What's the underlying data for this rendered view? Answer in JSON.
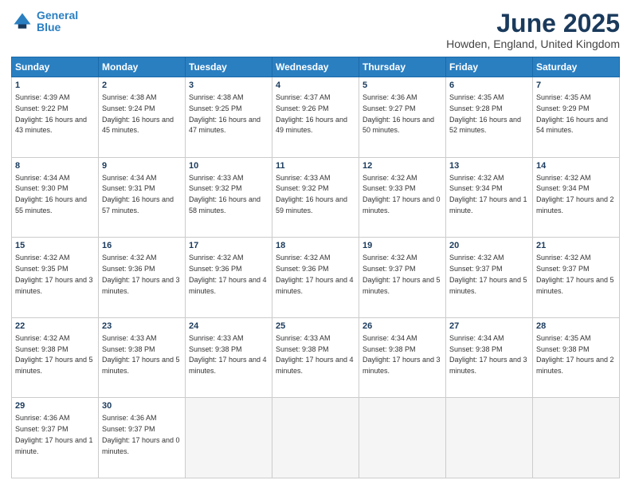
{
  "header": {
    "logo_line1": "General",
    "logo_line2": "Blue",
    "month": "June 2025",
    "location": "Howden, England, United Kingdom"
  },
  "weekdays": [
    "Sunday",
    "Monday",
    "Tuesday",
    "Wednesday",
    "Thursday",
    "Friday",
    "Saturday"
  ],
  "weeks": [
    [
      {
        "day": "1",
        "sunrise": "Sunrise: 4:39 AM",
        "sunset": "Sunset: 9:22 PM",
        "daylight": "Daylight: 16 hours and 43 minutes."
      },
      {
        "day": "2",
        "sunrise": "Sunrise: 4:38 AM",
        "sunset": "Sunset: 9:24 PM",
        "daylight": "Daylight: 16 hours and 45 minutes."
      },
      {
        "day": "3",
        "sunrise": "Sunrise: 4:38 AM",
        "sunset": "Sunset: 9:25 PM",
        "daylight": "Daylight: 16 hours and 47 minutes."
      },
      {
        "day": "4",
        "sunrise": "Sunrise: 4:37 AM",
        "sunset": "Sunset: 9:26 PM",
        "daylight": "Daylight: 16 hours and 49 minutes."
      },
      {
        "day": "5",
        "sunrise": "Sunrise: 4:36 AM",
        "sunset": "Sunset: 9:27 PM",
        "daylight": "Daylight: 16 hours and 50 minutes."
      },
      {
        "day": "6",
        "sunrise": "Sunrise: 4:35 AM",
        "sunset": "Sunset: 9:28 PM",
        "daylight": "Daylight: 16 hours and 52 minutes."
      },
      {
        "day": "7",
        "sunrise": "Sunrise: 4:35 AM",
        "sunset": "Sunset: 9:29 PM",
        "daylight": "Daylight: 16 hours and 54 minutes."
      }
    ],
    [
      {
        "day": "8",
        "sunrise": "Sunrise: 4:34 AM",
        "sunset": "Sunset: 9:30 PM",
        "daylight": "Daylight: 16 hours and 55 minutes."
      },
      {
        "day": "9",
        "sunrise": "Sunrise: 4:34 AM",
        "sunset": "Sunset: 9:31 PM",
        "daylight": "Daylight: 16 hours and 57 minutes."
      },
      {
        "day": "10",
        "sunrise": "Sunrise: 4:33 AM",
        "sunset": "Sunset: 9:32 PM",
        "daylight": "Daylight: 16 hours and 58 minutes."
      },
      {
        "day": "11",
        "sunrise": "Sunrise: 4:33 AM",
        "sunset": "Sunset: 9:32 PM",
        "daylight": "Daylight: 16 hours and 59 minutes."
      },
      {
        "day": "12",
        "sunrise": "Sunrise: 4:32 AM",
        "sunset": "Sunset: 9:33 PM",
        "daylight": "Daylight: 17 hours and 0 minutes."
      },
      {
        "day": "13",
        "sunrise": "Sunrise: 4:32 AM",
        "sunset": "Sunset: 9:34 PM",
        "daylight": "Daylight: 17 hours and 1 minute."
      },
      {
        "day": "14",
        "sunrise": "Sunrise: 4:32 AM",
        "sunset": "Sunset: 9:34 PM",
        "daylight": "Daylight: 17 hours and 2 minutes."
      }
    ],
    [
      {
        "day": "15",
        "sunrise": "Sunrise: 4:32 AM",
        "sunset": "Sunset: 9:35 PM",
        "daylight": "Daylight: 17 hours and 3 minutes."
      },
      {
        "day": "16",
        "sunrise": "Sunrise: 4:32 AM",
        "sunset": "Sunset: 9:36 PM",
        "daylight": "Daylight: 17 hours and 3 minutes."
      },
      {
        "day": "17",
        "sunrise": "Sunrise: 4:32 AM",
        "sunset": "Sunset: 9:36 PM",
        "daylight": "Daylight: 17 hours and 4 minutes."
      },
      {
        "day": "18",
        "sunrise": "Sunrise: 4:32 AM",
        "sunset": "Sunset: 9:36 PM",
        "daylight": "Daylight: 17 hours and 4 minutes."
      },
      {
        "day": "19",
        "sunrise": "Sunrise: 4:32 AM",
        "sunset": "Sunset: 9:37 PM",
        "daylight": "Daylight: 17 hours and 5 minutes."
      },
      {
        "day": "20",
        "sunrise": "Sunrise: 4:32 AM",
        "sunset": "Sunset: 9:37 PM",
        "daylight": "Daylight: 17 hours and 5 minutes."
      },
      {
        "day": "21",
        "sunrise": "Sunrise: 4:32 AM",
        "sunset": "Sunset: 9:37 PM",
        "daylight": "Daylight: 17 hours and 5 minutes."
      }
    ],
    [
      {
        "day": "22",
        "sunrise": "Sunrise: 4:32 AM",
        "sunset": "Sunset: 9:38 PM",
        "daylight": "Daylight: 17 hours and 5 minutes."
      },
      {
        "day": "23",
        "sunrise": "Sunrise: 4:33 AM",
        "sunset": "Sunset: 9:38 PM",
        "daylight": "Daylight: 17 hours and 5 minutes."
      },
      {
        "day": "24",
        "sunrise": "Sunrise: 4:33 AM",
        "sunset": "Sunset: 9:38 PM",
        "daylight": "Daylight: 17 hours and 4 minutes."
      },
      {
        "day": "25",
        "sunrise": "Sunrise: 4:33 AM",
        "sunset": "Sunset: 9:38 PM",
        "daylight": "Daylight: 17 hours and 4 minutes."
      },
      {
        "day": "26",
        "sunrise": "Sunrise: 4:34 AM",
        "sunset": "Sunset: 9:38 PM",
        "daylight": "Daylight: 17 hours and 3 minutes."
      },
      {
        "day": "27",
        "sunrise": "Sunrise: 4:34 AM",
        "sunset": "Sunset: 9:38 PM",
        "daylight": "Daylight: 17 hours and 3 minutes."
      },
      {
        "day": "28",
        "sunrise": "Sunrise: 4:35 AM",
        "sunset": "Sunset: 9:38 PM",
        "daylight": "Daylight: 17 hours and 2 minutes."
      }
    ],
    [
      {
        "day": "29",
        "sunrise": "Sunrise: 4:36 AM",
        "sunset": "Sunset: 9:37 PM",
        "daylight": "Daylight: 17 hours and 1 minute."
      },
      {
        "day": "30",
        "sunrise": "Sunrise: 4:36 AM",
        "sunset": "Sunset: 9:37 PM",
        "daylight": "Daylight: 17 hours and 0 minutes."
      },
      null,
      null,
      null,
      null,
      null
    ]
  ]
}
